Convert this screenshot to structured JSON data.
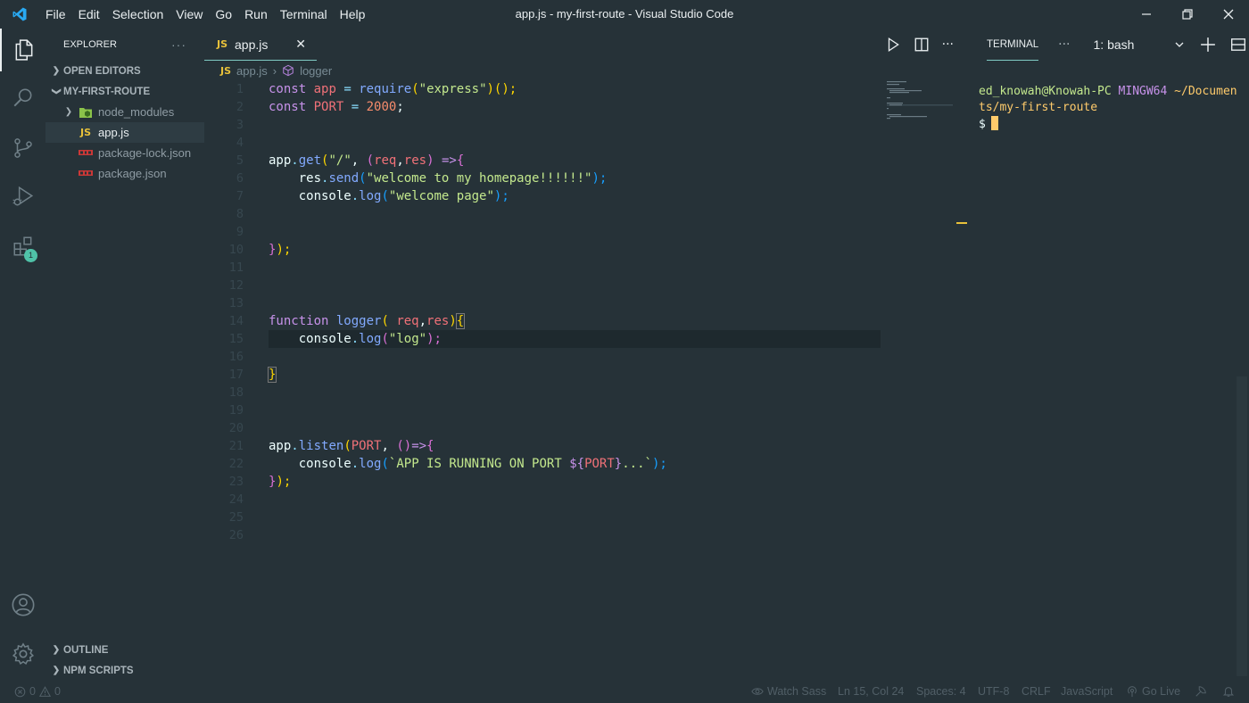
{
  "window": {
    "title": "app.js - my-first-route - Visual Studio Code",
    "menu": [
      "File",
      "Edit",
      "Selection",
      "View",
      "Go",
      "Run",
      "Terminal",
      "Help"
    ]
  },
  "activity_bar": {
    "extensions_badge": "1"
  },
  "sidebar": {
    "header": "EXPLORER",
    "header_more": "···",
    "open_editors": "OPEN EDITORS",
    "project": "MY-FIRST-ROUTE",
    "files": [
      {
        "name": "node_modules",
        "icon": "node-folder-icon"
      },
      {
        "name": "app.js",
        "icon": "js-file-icon",
        "icon_text": "JS"
      },
      {
        "name": "package-lock.json",
        "icon": "npm-icon"
      },
      {
        "name": "package.json",
        "icon": "npm-icon"
      }
    ],
    "outline": "OUTLINE",
    "npm_scripts": "NPM SCRIPTS"
  },
  "editor": {
    "tab": {
      "icon_text": "JS",
      "label": "app.js",
      "close": "✕"
    },
    "breadcrumb": {
      "file": "app.js",
      "symbol": "logger"
    },
    "line_numbers": [
      "1",
      "2",
      "3",
      "4",
      "5",
      "6",
      "7",
      "8",
      "9",
      "10",
      "11",
      "12",
      "13",
      "14",
      "15",
      "16",
      "17",
      "18",
      "19",
      "20",
      "21",
      "22",
      "23",
      "24",
      "25",
      "26"
    ],
    "current_line": 15,
    "code": {
      "l1": {
        "kw": "const",
        "name": "app",
        "eq": " = ",
        "fn": "require",
        "p1": "(",
        "str": "\"express\"",
        "p2": ")();"
      },
      "l2": {
        "kw": "const",
        "name": "PORT",
        "eq": " = ",
        "num": "2000",
        "end": ";"
      },
      "l5": {
        "obj": "app",
        "dot": ".",
        "fn": "get",
        "p1": "(",
        "str": "\"/\"",
        "comma": ", ",
        "p2": "(",
        "a1": "req",
        "c2": ",",
        "a2": "res",
        "p3": ")",
        "arrow": " =>",
        "b": "{"
      },
      "l6": {
        "obj": "res",
        "dot": ".",
        "fn": "send",
        "p1": "(",
        "str": "\"welcome to my homepage!!!!!!\"",
        "end": ");"
      },
      "l7": {
        "obj": "console",
        "dot": ".",
        "fn": "log",
        "p1": "(",
        "str": "\"welcome page\"",
        "end": ");"
      },
      "l10": {
        "b": "}",
        "end": ");"
      },
      "l14": {
        "kw": "function",
        "fn": "logger",
        "p1": "(",
        "a1": " req",
        "c": ",",
        "a2": "res",
        "p2": ")",
        "b": "{"
      },
      "l15": {
        "obj": "console",
        "dot": ".",
        "fn": "log",
        "p1": "(",
        "str": "\"log\"",
        "end": ");"
      },
      "l17": {
        "b": "}"
      },
      "l21": {
        "obj": "app",
        "dot": ".",
        "fn": "listen",
        "p1": "(",
        "arg": "PORT",
        "comma": ", ",
        "p2": "()",
        "arrow": "=>",
        "b": "{"
      },
      "l22": {
        "obj": "console",
        "dot": ".",
        "fn": "log",
        "p1": "(",
        "t1": "`APP IS RUNNING ON PORT ",
        "ti": "${",
        "tv": "PORT",
        "tc": "}",
        "t2": "...`",
        "end": ");"
      },
      "l23": {
        "b": "}",
        "end": ");"
      }
    }
  },
  "terminal": {
    "tab": "TERMINAL",
    "more": "···",
    "selector": "1: bash",
    "user": "ed_knowah@Knowah-PC",
    "shell": "MINGW64",
    "path1": "~/Documen",
    "path2": "ts/my-first-route",
    "prompt": "$"
  },
  "status_bar": {
    "errors": "0",
    "warnings": "0",
    "watch_sass": "Watch Sass",
    "position": "Ln 15, Col 24",
    "spaces": "Spaces: 4",
    "encoding": "UTF-8",
    "eol": "CRLF",
    "language": "JavaScript",
    "go_live": "Go Live"
  },
  "colors": {
    "background": "#263238",
    "keyword": "#c792ea",
    "function": "#82aaff",
    "string": "#c3e88d",
    "number": "#f78c6c",
    "variable": "#f07178",
    "accent": "#80cbc4"
  }
}
